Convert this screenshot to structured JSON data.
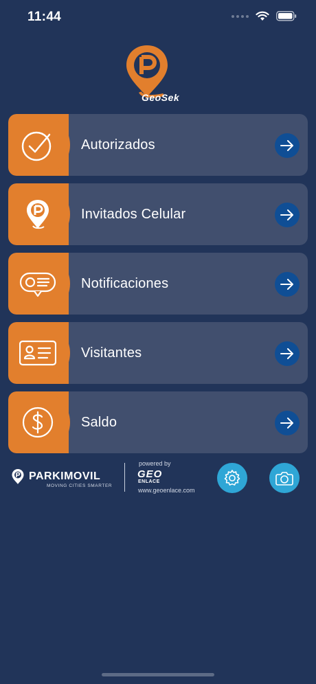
{
  "status_bar": {
    "time": "11:44"
  },
  "app": {
    "logo_text": "GeoSek"
  },
  "menu": {
    "items": [
      {
        "label": "Autorizados",
        "icon": "check-circle-icon"
      },
      {
        "label": "Invitados Celular",
        "icon": "location-pin-p-icon"
      },
      {
        "label": "Notificaciones",
        "icon": "message-bubble-icon"
      },
      {
        "label": "Visitantes",
        "icon": "id-card-icon"
      },
      {
        "label": "Saldo",
        "icon": "dollar-circle-icon"
      }
    ]
  },
  "footer": {
    "parkimovil_name": "PARKIMOVIL",
    "parkimovil_tagline": "MOVING CITIES SMARTER",
    "powered_by": "powered by",
    "geo_name": "GEO",
    "geo_sub": "ENLACE",
    "geo_url": "www.geoenlace.com"
  },
  "colors": {
    "background": "#213459",
    "card": "#414f6e",
    "accent_orange": "#e27f2d",
    "arrow_blue": "#0f4e95",
    "action_blue": "#2fa6d6"
  }
}
